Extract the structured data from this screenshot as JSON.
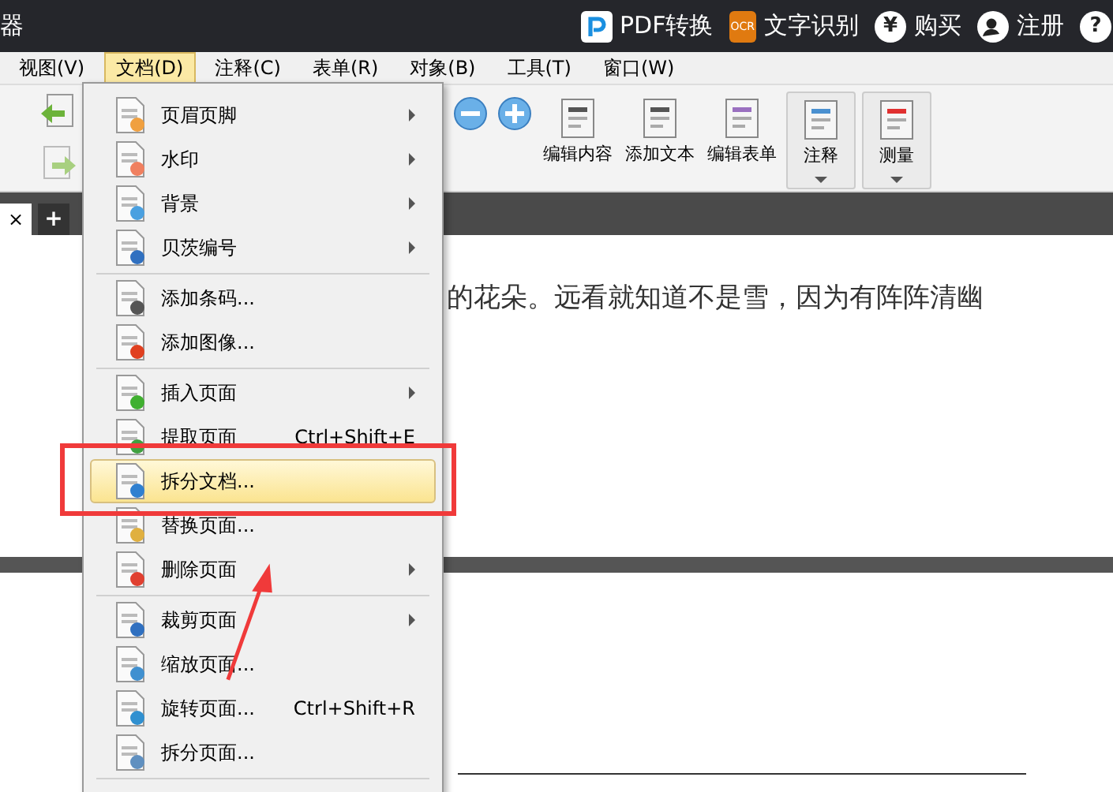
{
  "title_bar": {
    "title": "器",
    "actions": [
      {
        "kind": "pdf",
        "label": "PDF转换"
      },
      {
        "kind": "ocr",
        "badge": "OCR",
        "label": "文字识别"
      },
      {
        "kind": "glyph",
        "glyph": "¥",
        "label": "购买"
      },
      {
        "kind": "user",
        "label": "注册"
      },
      {
        "kind": "glyph",
        "glyph": "?"
      }
    ]
  },
  "menu_bar": [
    {
      "label": "视图(V)",
      "selected": false
    },
    {
      "label": "文档(D)",
      "selected": true
    },
    {
      "label": "注释(C)",
      "selected": false
    },
    {
      "label": "表单(R)",
      "selected": false
    },
    {
      "label": "对象(B)",
      "selected": false
    },
    {
      "label": "工具(T)",
      "selected": false
    },
    {
      "label": "窗口(W)",
      "selected": false
    }
  ],
  "toolbar": [
    {
      "label": "编辑内容",
      "dropdown": false
    },
    {
      "label": "添加文本",
      "dropdown": false
    },
    {
      "label": "编辑表单",
      "dropdown": false
    },
    {
      "label": "注释",
      "dropdown": true
    },
    {
      "label": "测量",
      "dropdown": true
    }
  ],
  "tab_bar": {
    "close": "×",
    "add": "+"
  },
  "document": {
    "line": "的花朵。远看就知道不是雪，因为有阵阵清幽"
  },
  "dropdown_menu": [
    {
      "kind": "item",
      "label": "页眉页脚",
      "submenu": true,
      "selected": false
    },
    {
      "kind": "item",
      "label": "水印",
      "submenu": true,
      "selected": false
    },
    {
      "kind": "item",
      "label": "背景",
      "submenu": true,
      "selected": false
    },
    {
      "kind": "item",
      "label": "贝茨编号",
      "submenu": true,
      "selected": false
    },
    {
      "kind": "separator"
    },
    {
      "kind": "item",
      "label": "添加条码...",
      "submenu": false,
      "selected": false
    },
    {
      "kind": "item",
      "label": "添加图像...",
      "submenu": false,
      "selected": false
    },
    {
      "kind": "separator"
    },
    {
      "kind": "item",
      "label": "插入页面",
      "submenu": true,
      "selected": false
    },
    {
      "kind": "item",
      "label": "提取页面",
      "shortcut": "Ctrl+Shift+E",
      "submenu": false,
      "selected": false
    },
    {
      "kind": "item",
      "label": "拆分文档...",
      "submenu": false,
      "selected": true
    },
    {
      "kind": "item",
      "label": "替换页面...",
      "submenu": false,
      "selected": false
    },
    {
      "kind": "item",
      "label": "删除页面",
      "submenu": true,
      "selected": false
    },
    {
      "kind": "separator"
    },
    {
      "kind": "item",
      "label": "裁剪页面",
      "submenu": true,
      "selected": false
    },
    {
      "kind": "item",
      "label": "缩放页面...",
      "submenu": false,
      "selected": false
    },
    {
      "kind": "item",
      "label": "旋转页面...",
      "shortcut": "Ctrl+Shift+R",
      "submenu": false,
      "selected": false
    },
    {
      "kind": "item",
      "label": "拆分页面...",
      "submenu": false,
      "selected": false
    },
    {
      "kind": "separator"
    }
  ]
}
